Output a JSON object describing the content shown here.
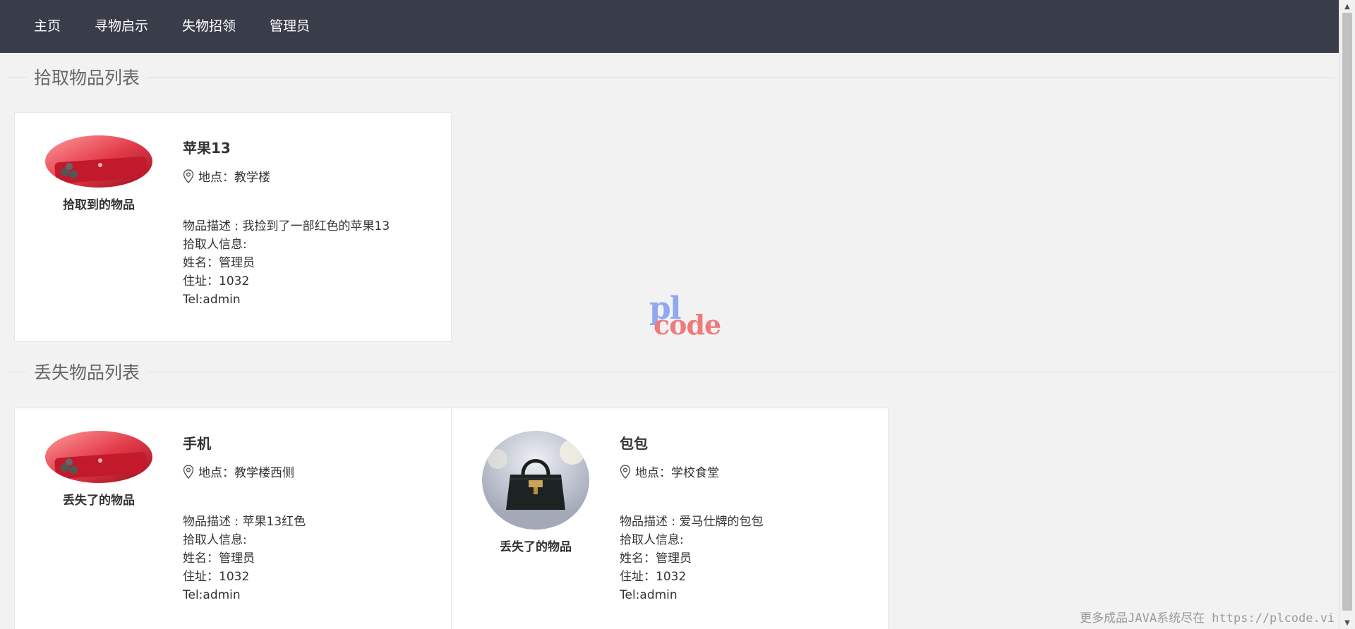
{
  "nav": {
    "items": [
      {
        "label": "主页"
      },
      {
        "label": "寻物启示"
      },
      {
        "label": "失物招领"
      },
      {
        "label": "管理员"
      }
    ]
  },
  "sections": {
    "found": {
      "title": "拾取物品列表"
    },
    "lost": {
      "title": "丢失物品列表"
    }
  },
  "cards": [
    {
      "name": "苹果13",
      "location_label": "地点：",
      "location": "教学楼",
      "image_label": "拾取到的物品",
      "description": "物品描述 : 我捡到了一部红色的苹果13",
      "finder_label": "拾取人信息:",
      "name_line": "姓名：管理员",
      "address_line": "住址：1032",
      "tel_line": "Tel:admin"
    },
    {
      "name": "手机",
      "location_label": "地点：",
      "location": "教学楼西侧",
      "image_label": "丢失了的物品",
      "description": "物品描述 : 苹果13红色",
      "finder_label": "拾取人信息:",
      "name_line": "姓名：管理员",
      "address_line": "住址：1032",
      "tel_line": "Tel:admin"
    },
    {
      "name": "包包",
      "location_label": "地点：",
      "location": "学校食堂",
      "image_label": "丢失了的物品",
      "description": "物品描述 : 爱马仕牌的包包",
      "finder_label": "拾取人信息:",
      "name_line": "姓名：管理员",
      "address_line": "住址：1032",
      "tel_line": "Tel:admin"
    }
  ],
  "watermark": {
    "logo_top": "pl",
    "logo_bottom": "code",
    "footer": "更多成品JAVA系统尽在 https://plcode.vi"
  },
  "icons": {
    "location": "map-pin-icon",
    "scroll_up": "scroll-up-arrow-icon",
    "scroll_down": "scroll-down-arrow-icon"
  },
  "colors": {
    "nav_bg": "#393d49",
    "page_bg": "#f2f2f2",
    "card_bg": "#ffffff"
  }
}
